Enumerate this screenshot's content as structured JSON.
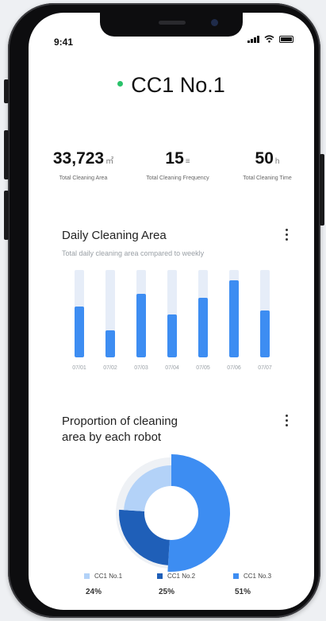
{
  "status": {
    "time": "9:41"
  },
  "robot": {
    "name": "CC1 No.1",
    "status_color": "#2ac26a"
  },
  "stats": [
    {
      "value": "33,723",
      "unit": "㎡",
      "label": "Total Cleaning Area"
    },
    {
      "value": "15",
      "unit": "≡",
      "label": "Total Cleaning Frequency"
    },
    {
      "value": "50",
      "unit": "h",
      "label": "Total Cleaning Time"
    }
  ],
  "daily": {
    "title": "Daily Cleaning Area",
    "subtitle": "Total daily cleaning area compared to weekly"
  },
  "proportion": {
    "title_line1": "Proportion of cleaning",
    "title_line2": "area by each robot"
  },
  "colors": {
    "accent": "#3d8df2",
    "track": "#e6edf8",
    "dark": "#1f5fb8",
    "light": "#b3d2f8"
  },
  "chart_data": [
    {
      "type": "bar",
      "title": "Daily Cleaning Area",
      "subtitle": "Total daily cleaning area compared to weekly",
      "categories": [
        "07/01",
        "07/02",
        "07/03",
        "07/04",
        "07/05",
        "07/06",
        "07/07"
      ],
      "values": [
        0.58,
        0.31,
        0.73,
        0.49,
        0.68,
        0.88,
        0.54
      ],
      "max_values": [
        1,
        1,
        1,
        1,
        1,
        1,
        1
      ]
    },
    {
      "type": "pie",
      "title": "Proportion of cleaning area by each robot",
      "labels": [
        "CC1 No.1",
        "CC1 No.2",
        "CC1 No.3"
      ],
      "values": [
        24,
        25,
        51
      ],
      "display": [
        "24%",
        "25%",
        "51%"
      ],
      "colors": [
        "#b3d2f8",
        "#1f5fb8",
        "#3d8df2"
      ]
    }
  ]
}
